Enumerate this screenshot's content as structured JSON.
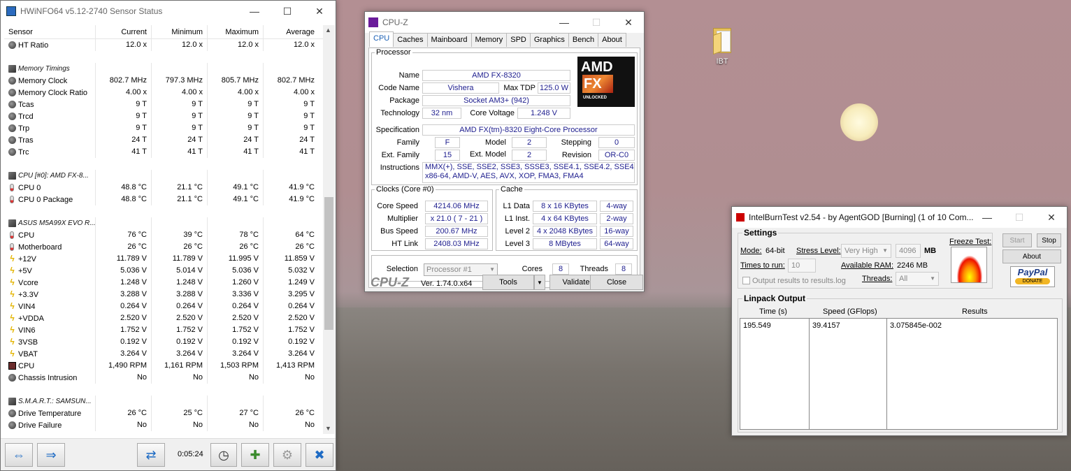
{
  "desktop": {
    "icon_label": "IBT"
  },
  "hwinfo": {
    "title": "HWiNFO64 v5.12-2740 Sensor Status",
    "columns": [
      "Sensor",
      "Current",
      "Minimum",
      "Maximum",
      "Average"
    ],
    "rows": [
      {
        "t": "row",
        "icon": "circ",
        "name": "HT Ratio",
        "v": [
          "12.0 x",
          "12.0 x",
          "12.0 x",
          "12.0 x"
        ]
      },
      {
        "t": "blank"
      },
      {
        "t": "grp",
        "icon": "chip",
        "name": "Memory Timings"
      },
      {
        "t": "row",
        "icon": "circ",
        "name": "Memory Clock",
        "v": [
          "802.7 MHz",
          "797.3 MHz",
          "805.7 MHz",
          "802.7 MHz"
        ]
      },
      {
        "t": "row",
        "icon": "circ",
        "name": "Memory Clock Ratio",
        "v": [
          "4.00 x",
          "4.00 x",
          "4.00 x",
          "4.00 x"
        ]
      },
      {
        "t": "row",
        "icon": "circ",
        "name": "Tcas",
        "v": [
          "9 T",
          "9 T",
          "9 T",
          "9 T"
        ]
      },
      {
        "t": "row",
        "icon": "circ",
        "name": "Trcd",
        "v": [
          "9 T",
          "9 T",
          "9 T",
          "9 T"
        ]
      },
      {
        "t": "row",
        "icon": "circ",
        "name": "Trp",
        "v": [
          "9 T",
          "9 T",
          "9 T",
          "9 T"
        ]
      },
      {
        "t": "row",
        "icon": "circ",
        "name": "Tras",
        "v": [
          "24 T",
          "24 T",
          "24 T",
          "24 T"
        ]
      },
      {
        "t": "row",
        "icon": "circ",
        "name": "Trc",
        "v": [
          "41 T",
          "41 T",
          "41 T",
          "41 T"
        ]
      },
      {
        "t": "blank"
      },
      {
        "t": "grp",
        "icon": "chip",
        "name": "CPU [#0]: AMD FX-8..."
      },
      {
        "t": "row",
        "icon": "therm",
        "name": "CPU 0",
        "v": [
          "48.8 °C",
          "21.1 °C",
          "49.1 °C",
          "41.9 °C"
        ]
      },
      {
        "t": "row",
        "icon": "therm",
        "name": "CPU 0 Package",
        "v": [
          "48.8 °C",
          "21.1 °C",
          "49.1 °C",
          "41.9 °C"
        ]
      },
      {
        "t": "blank"
      },
      {
        "t": "grp",
        "icon": "chip",
        "name": "ASUS M5A99X EVO R..."
      },
      {
        "t": "row",
        "icon": "therm",
        "name": "CPU",
        "v": [
          "76 °C",
          "39 °C",
          "78 °C",
          "64 °C"
        ]
      },
      {
        "t": "row",
        "icon": "therm",
        "name": "Motherboard",
        "v": [
          "26 °C",
          "26 °C",
          "26 °C",
          "26 °C"
        ]
      },
      {
        "t": "row",
        "icon": "volt",
        "name": "+12V",
        "v": [
          "11.789 V",
          "11.789 V",
          "11.995 V",
          "11.859 V"
        ]
      },
      {
        "t": "row",
        "icon": "volt",
        "name": "+5V",
        "v": [
          "5.036 V",
          "5.014 V",
          "5.036 V",
          "5.032 V"
        ]
      },
      {
        "t": "row",
        "icon": "volt",
        "name": "Vcore",
        "v": [
          "1.248 V",
          "1.248 V",
          "1.260 V",
          "1.249 V"
        ]
      },
      {
        "t": "row",
        "icon": "volt",
        "name": "+3.3V",
        "v": [
          "3.288 V",
          "3.288 V",
          "3.336 V",
          "3.295 V"
        ]
      },
      {
        "t": "row",
        "icon": "volt",
        "name": "VIN4",
        "v": [
          "0.264 V",
          "0.264 V",
          "0.264 V",
          "0.264 V"
        ]
      },
      {
        "t": "row",
        "icon": "volt",
        "name": "+VDDA",
        "v": [
          "2.520 V",
          "2.520 V",
          "2.520 V",
          "2.520 V"
        ]
      },
      {
        "t": "row",
        "icon": "volt",
        "name": "VIN6",
        "v": [
          "1.752 V",
          "1.752 V",
          "1.752 V",
          "1.752 V"
        ]
      },
      {
        "t": "row",
        "icon": "volt",
        "name": "3VSB",
        "v": [
          "0.192 V",
          "0.192 V",
          "0.192 V",
          "0.192 V"
        ]
      },
      {
        "t": "row",
        "icon": "volt",
        "name": "VBAT",
        "v": [
          "3.264 V",
          "3.264 V",
          "3.264 V",
          "3.264 V"
        ]
      },
      {
        "t": "row",
        "icon": "fan",
        "name": "CPU",
        "v": [
          "1,490 RPM",
          "1,161 RPM",
          "1,503 RPM",
          "1,413 RPM"
        ]
      },
      {
        "t": "row",
        "icon": "circ",
        "name": "Chassis Intrusion",
        "v": [
          "No",
          "No",
          "No",
          "No"
        ]
      },
      {
        "t": "blank"
      },
      {
        "t": "grp",
        "icon": "chip",
        "name": "S.M.A.R.T.: SAMSUN..."
      },
      {
        "t": "row",
        "icon": "circ",
        "name": "Drive Temperature",
        "v": [
          "26 °C",
          "25 °C",
          "27 °C",
          "26 °C"
        ]
      },
      {
        "t": "row",
        "icon": "circ",
        "name": "Drive Failure",
        "v": [
          "No",
          "No",
          "No",
          "No"
        ]
      }
    ],
    "timer": "0:05:24"
  },
  "cpuz": {
    "title": "CPU-Z",
    "tabs": [
      "CPU",
      "Caches",
      "Mainboard",
      "Memory",
      "SPD",
      "Graphics",
      "Bench",
      "About"
    ],
    "processor_legend": "Processor",
    "labels": {
      "name": "Name",
      "codename": "Code Name",
      "maxtdp": "Max TDP",
      "package": "Package",
      "technology": "Technology",
      "corevoltage": "Core Voltage",
      "specification": "Specification",
      "family": "Family",
      "model": "Model",
      "stepping": "Stepping",
      "extfamily": "Ext. Family",
      "extmodel": "Ext. Model",
      "revision": "Revision",
      "instructions": "Instructions"
    },
    "values": {
      "name": "AMD FX-8320",
      "codename": "Vishera",
      "maxtdp": "125.0 W",
      "package": "Socket AM3+ (942)",
      "technology": "32 nm",
      "corevoltage": "1.248 V",
      "specification": "AMD FX(tm)-8320 Eight-Core Processor",
      "family": "F",
      "model": "2",
      "stepping": "0",
      "extfamily": "15",
      "extmodel": "2",
      "revision": "OR-C0",
      "instructions_1": "MMX(+), SSE, SSE2, SSE3, SSSE3, SSE4.1, SSE4.2, SSE4A,",
      "instructions_2": "x86-64, AMD-V, AES, AVX, XOP, FMA3, FMA4"
    },
    "logo": {
      "brand": "AMD",
      "fx": "FX",
      "sub": "UNLOCKED"
    },
    "clocks": {
      "legend": "Clocks (Core #0)",
      "corespeed_l": "Core Speed",
      "corespeed": "4214.06 MHz",
      "multiplier_l": "Multiplier",
      "multiplier": "x 21.0 ( 7 - 21 )",
      "busspeed_l": "Bus Speed",
      "busspeed": "200.67 MHz",
      "htlink_l": "HT Link",
      "htlink": "2408.03 MHz"
    },
    "cache": {
      "legend": "Cache",
      "l1d_l": "L1 Data",
      "l1d": "8 x 16 KBytes",
      "l1d_w": "4-way",
      "l1i_l": "L1 Inst.",
      "l1i": "4 x 64 KBytes",
      "l1i_w": "2-way",
      "l2_l": "Level 2",
      "l2": "4 x 2048 KBytes",
      "l2_w": "16-way",
      "l3_l": "Level 3",
      "l3": "8 MBytes",
      "l3_w": "64-way"
    },
    "selection_l": "Selection",
    "selection": "Processor #1",
    "cores_l": "Cores",
    "cores": "8",
    "threads_l": "Threads",
    "threads": "8",
    "footer": {
      "logo": "CPU-Z",
      "version": "Ver. 1.74.0.x64",
      "tools": "Tools",
      "validate": "Validate",
      "close": "Close"
    }
  },
  "ibt": {
    "title": "IntelBurnTest v2.54 - by AgentGOD [Burning] (1 of 10 Com...",
    "settings": "Settings",
    "mode_l": "Mode:",
    "mode": "64-bit",
    "stress_l": "Stress Level:",
    "stress": "Very High",
    "mem": "4096",
    "mb": "MB",
    "times_l": "Times to run:",
    "times": "10",
    "ram_l": "Available RAM:",
    "ram": "2246 MB",
    "output_l": "Output results to results.log",
    "threads_l": "Threads:",
    "threads": "All",
    "freeze_l": "Freeze Test:",
    "start": "Start",
    "stop": "Stop",
    "about": "About",
    "paypal": "PayPal",
    "donate": "DONATE",
    "linpack": "Linpack Output",
    "cols": [
      "Time (s)",
      "Speed (GFlops)",
      "Results"
    ],
    "row": [
      "195.549",
      "39.4157",
      "3.075845e-002"
    ]
  }
}
